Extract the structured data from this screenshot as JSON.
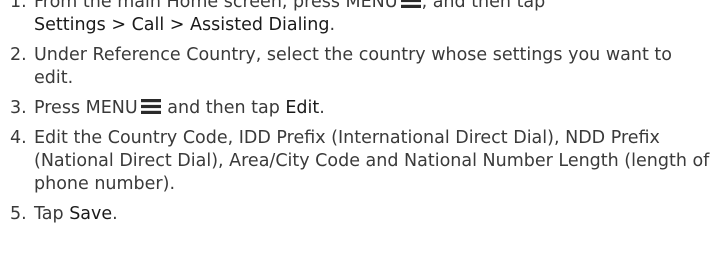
{
  "steps": [
    {
      "number": "1.",
      "part1": "From the main Home screen, press MENU",
      "part2": ", and then tap",
      "path": "Settings > Call > Assisted Dialing",
      "part3": "."
    },
    {
      "number": "2.",
      "text": "Under Reference Country, select the country whose settings you want to edit."
    },
    {
      "number": "3.",
      "part1": "Press MENU",
      "part2": " and then tap ",
      "action": "Edit",
      "part3": "."
    },
    {
      "number": "4.",
      "text": "Edit the Country Code, IDD Prefix (International Direct Dial), NDD Prefix (National Direct Dial), Area/City Code and National Number Length (length of phone number)."
    },
    {
      "number": "5.",
      "part1": "Tap ",
      "action": "Save",
      "part3": "."
    }
  ],
  "icons": {
    "menu": "menu-icon"
  },
  "colors": {
    "text": "#3a3a3a",
    "emphasis": "#1a1a1a"
  }
}
